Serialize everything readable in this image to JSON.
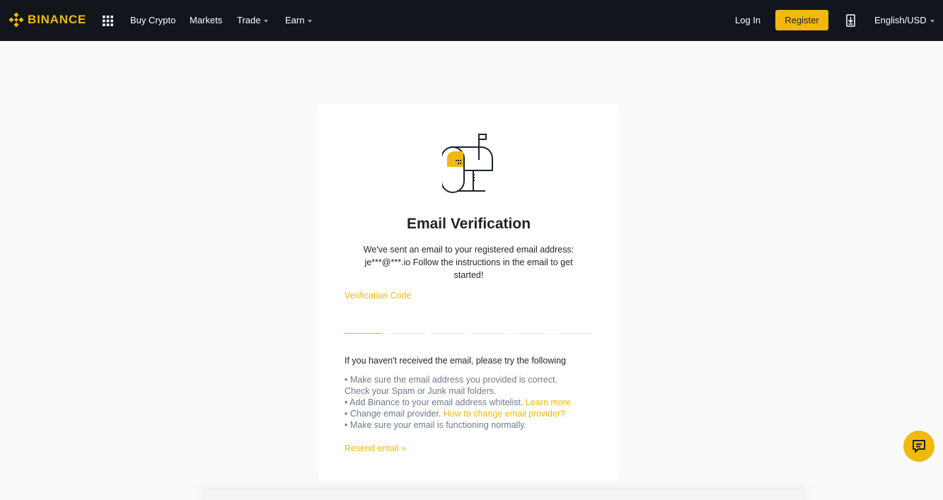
{
  "header": {
    "brand": "BINANCE",
    "nav": [
      {
        "label": "Buy Crypto",
        "has_caret": false
      },
      {
        "label": "Markets",
        "has_caret": false
      },
      {
        "label": "Trade",
        "has_caret": true
      },
      {
        "label": "Earn",
        "has_caret": true
      }
    ],
    "login_label": "Log In",
    "register_label": "Register",
    "language_label": "English/USD"
  },
  "card": {
    "title": "Email Verification",
    "description": "We've sent an email to your registered email address: je***@***.io Follow the instructions in the email to get started!",
    "code_label": "Verification Code",
    "code_digits": [
      "",
      "",
      "",
      "",
      "",
      ""
    ],
    "help_title": "If you haven't received the email, please try the following",
    "tips": {
      "tip1": "• Make sure the email address you provided is correct.",
      "tip2": "Check your Spam or Junk mail folders.",
      "tip3": "• Add Binance to your email address whitelist.",
      "tip3_link": "Learn more",
      "tip4": "• Change email provider.",
      "tip4_link": "How to change email provider?",
      "tip5": "• Make sure your email is functioning normally."
    },
    "resend_label": "Resend email »"
  },
  "colors": {
    "brand": "#f0b90b",
    "header_bg": "#12161c",
    "page_bg": "#fafafa",
    "muted_text": "#707a8a"
  },
  "icons": {
    "logo": "binance-logo-icon",
    "apps": "grid-icon",
    "download": "download-icon",
    "mailbox": "mailbox-icon",
    "chat": "chat-icon"
  }
}
